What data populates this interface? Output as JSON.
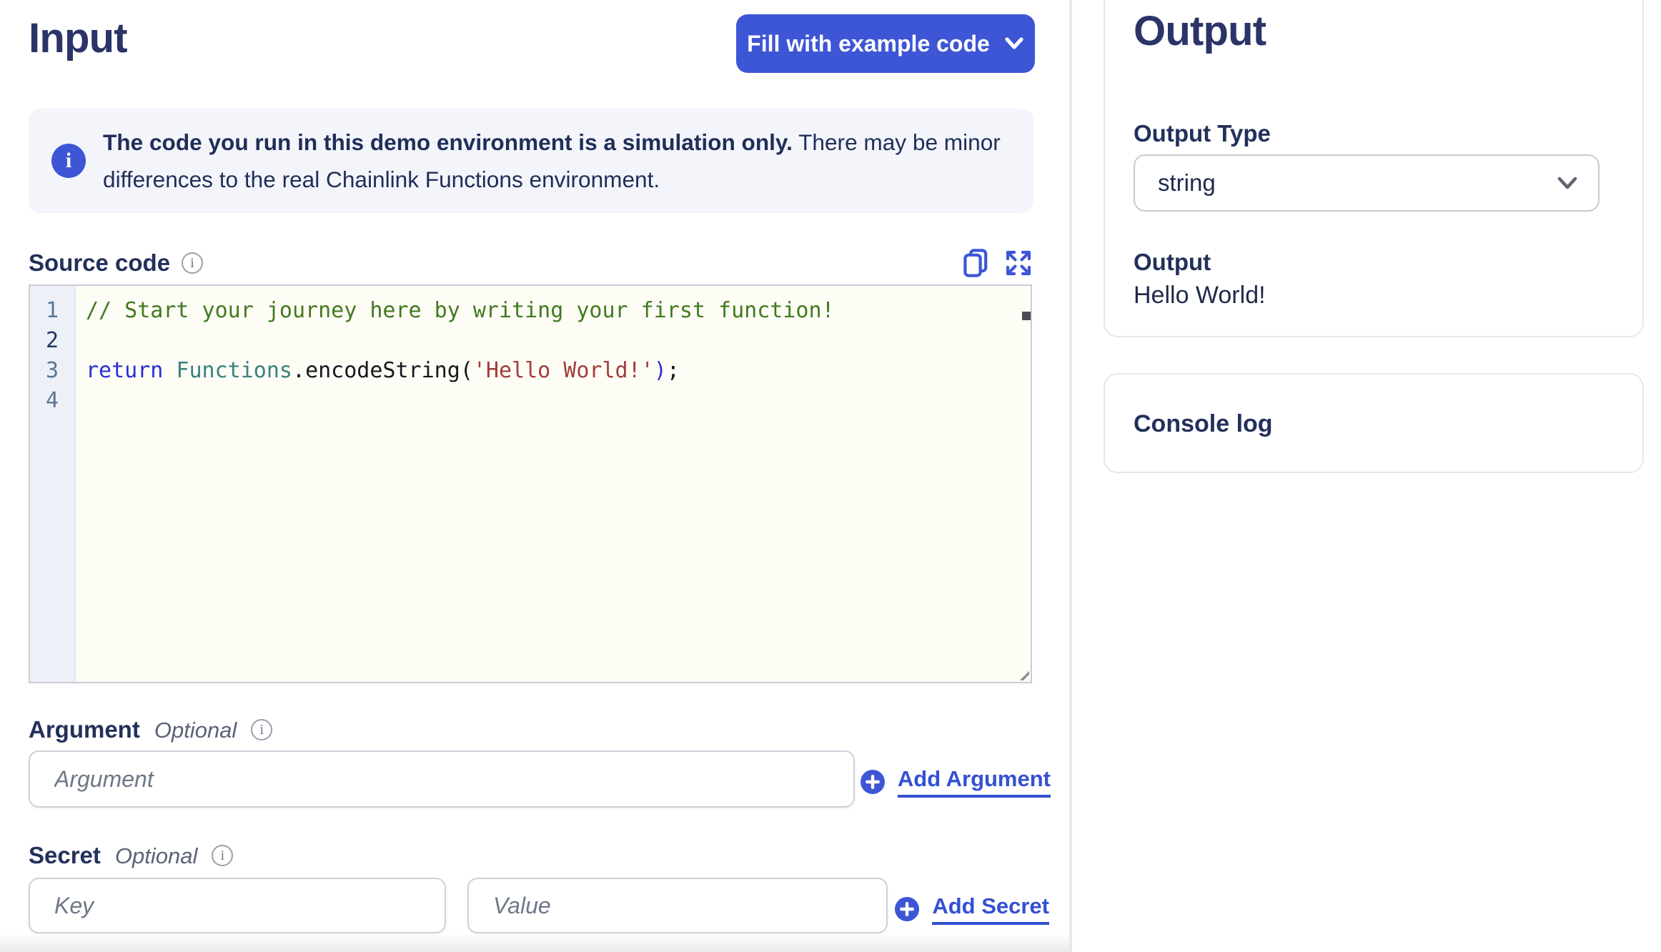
{
  "colors": {
    "accent_blue": "#3D56D6",
    "link_blue": "#3450D2",
    "heading_navy": "#2B3468",
    "label_navy": "#22305A",
    "banner_bg": "#F3F5FB",
    "editor_bg": "#FDFCF5",
    "gutter_bg": "#EDF1F7",
    "token_comment_green": "#427A1E",
    "token_keyword_blue": "#2A2FD4",
    "token_type_teal": "#398280",
    "token_string_red": "#A33C3C"
  },
  "input_panel": {
    "title": "Input",
    "fill_button_label": "Fill with example code",
    "banner_bold": "The code you run in this demo environment is a simulation only.",
    "banner_rest": " There may be minor differences to the real Chainlink Functions environment.",
    "source_code_label": "Source code",
    "argument": {
      "label": "Argument",
      "optional": "Optional",
      "placeholder": "Argument",
      "add_label": "Add Argument"
    },
    "secret": {
      "label": "Secret",
      "optional": "Optional",
      "key_placeholder": "Key",
      "value_placeholder": "Value",
      "add_label": "Add Secret"
    }
  },
  "source_code": {
    "active_line": 2,
    "lines": [
      {
        "num": 1,
        "tokens": [
          {
            "t": "comment",
            "s": "// Start your journey here by writing your first function!"
          }
        ]
      },
      {
        "num": 2,
        "tokens": []
      },
      {
        "num": 3,
        "tokens": [
          {
            "t": "keyword",
            "s": "return"
          },
          {
            "t": "plain",
            "s": " "
          },
          {
            "t": "type",
            "s": "Functions"
          },
          {
            "t": "plain",
            "s": "."
          },
          {
            "t": "plain",
            "s": "encodeString"
          },
          {
            "t": "plain",
            "s": "("
          },
          {
            "t": "string",
            "s": "'Hello World!'"
          },
          {
            "t": "paren",
            "s": ")"
          },
          {
            "t": "plain",
            "s": ";"
          }
        ]
      },
      {
        "num": 4,
        "tokens": []
      }
    ]
  },
  "output_panel": {
    "title": "Output",
    "type_label": "Output Type",
    "type_value": "string",
    "output_label": "Output",
    "output_value": "Hello World!",
    "console_label": "Console log"
  }
}
